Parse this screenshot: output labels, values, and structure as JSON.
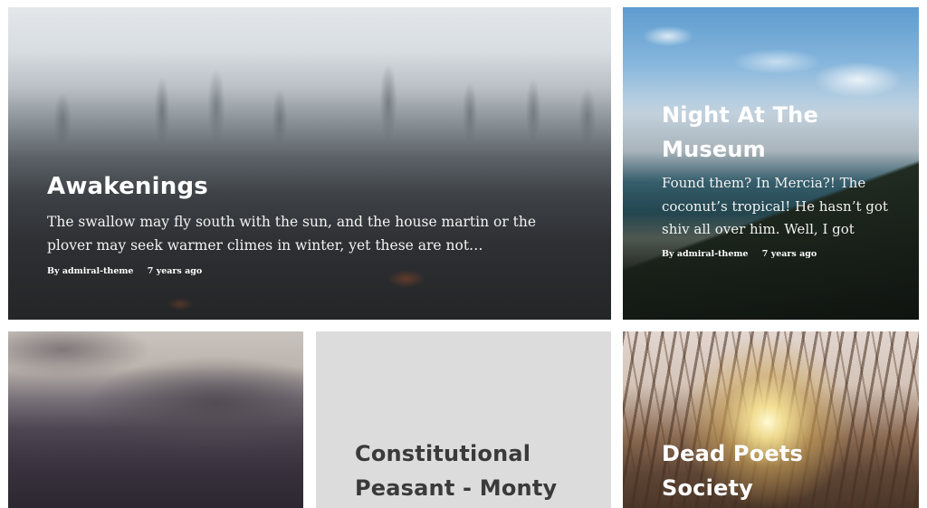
{
  "posts": [
    {
      "title": "Awakenings",
      "excerpt": "The swallow may fly south with the sun, and the house martin or the plover may seek warmer climes in winter, yet these are not…",
      "author": "By admiral-theme",
      "date": "7 years ago"
    },
    {
      "title": "Night At The Museum",
      "excerpt": "Found them? In Mercia?! The coconut’s tropical! He hasn’t got shiv all over him. Well, I got better. Who’s that then…",
      "author": "By admiral-theme",
      "date": "7 years ago"
    },
    {
      "title": ""
    },
    {
      "title": "Constitutional Peasant - Monty"
    },
    {
      "title": "Dead Poets Society"
    }
  ]
}
